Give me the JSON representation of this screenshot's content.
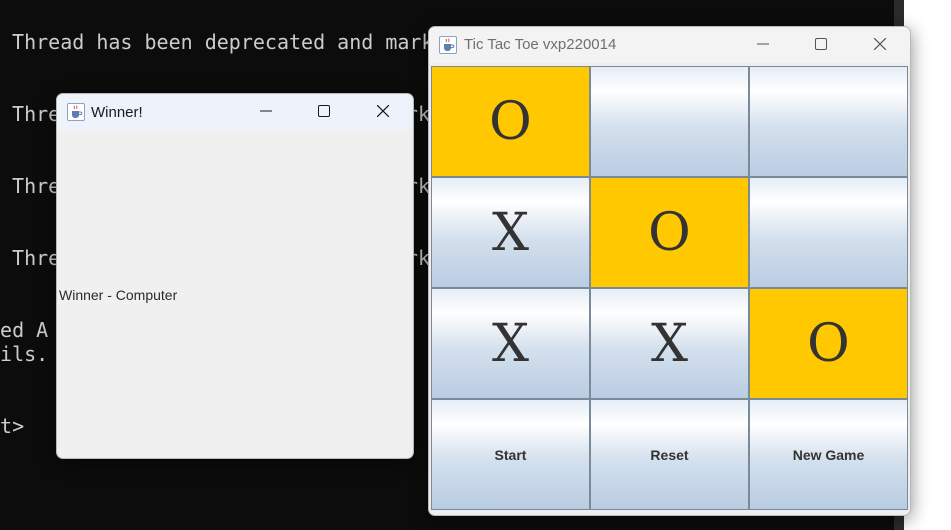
{
  "terminal": {
    "lines": [
      " Thread has been deprecated and mark",
      " Thre",
      "rk",
      " Thre",
      "rk",
      " Thre",
      "rk",
      "ted A",
      "ails.",
      "tt>"
    ]
  },
  "winner_window": {
    "title": "Winner!",
    "message": "Winner - Computer"
  },
  "game_window": {
    "title": "Tic Tac Toe vxp220014",
    "board": [
      {
        "mark": "O",
        "highlight": true
      },
      {
        "mark": "",
        "highlight": false
      },
      {
        "mark": "",
        "highlight": false
      },
      {
        "mark": "X",
        "highlight": false
      },
      {
        "mark": "O",
        "highlight": true
      },
      {
        "mark": "",
        "highlight": false
      },
      {
        "mark": "X",
        "highlight": false
      },
      {
        "mark": "X",
        "highlight": false
      },
      {
        "mark": "O",
        "highlight": true
      }
    ],
    "buttons": {
      "start": "Start",
      "reset": "Reset",
      "new_game": "New Game"
    },
    "highlight_color": "#ffc800"
  },
  "icons": {
    "app": "java-cup-icon",
    "minimize": "minimize-icon",
    "maximize": "maximize-icon",
    "close": "close-icon"
  }
}
